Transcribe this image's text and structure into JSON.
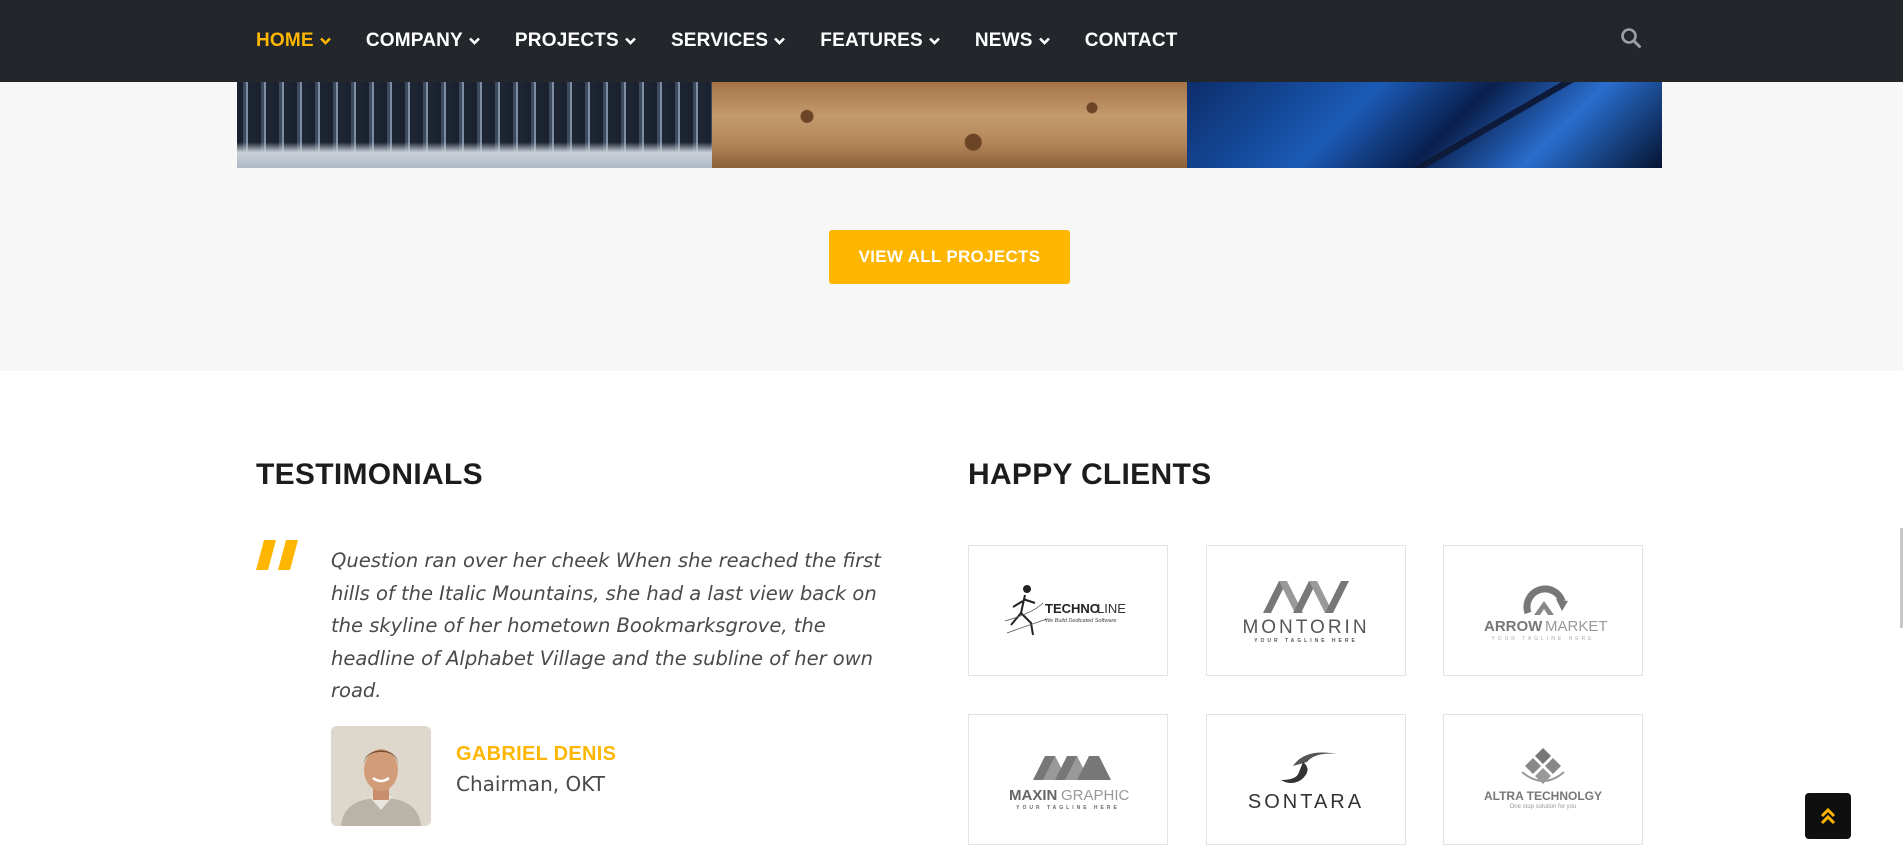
{
  "nav": {
    "items": [
      {
        "label": "HOME",
        "active": true
      },
      {
        "label": "COMPANY"
      },
      {
        "label": "PROJECTS"
      },
      {
        "label": "SERVICES"
      },
      {
        "label": "FEATURES"
      },
      {
        "label": "NEWS"
      },
      {
        "label": "CONTACT"
      }
    ],
    "search_icon": "search-icon"
  },
  "projects": {
    "button_label": "VIEW ALL PROJECTS"
  },
  "testimonials": {
    "title": "TESTIMONIALS",
    "quote": "Question ran over her cheek When she reached the first hills of the Italic Mountains, she had a last view back on the skyline of her hometown Bookmarksgrove, the headline of Alphabet Village and the subline of her own road.",
    "author_name": "GABRIEL DENIS",
    "author_role": "Chairman, OKT"
  },
  "clients": {
    "title": "HAPPY CLIENTS",
    "logos": [
      {
        "name": "TECHNO",
        "name2": "LINE",
        "tagline": "We Build Dedicated Software"
      },
      {
        "name": "MONTORIN",
        "tagline": "YOUR TAGLINE HERE"
      },
      {
        "name": "ARROW",
        "name2": "MARKET",
        "tagline": "YOUR TAGLINE HERE"
      },
      {
        "name": "MAXIN",
        "name2": "GRAPHIC",
        "tagline": "YOUR TAGLINE HERE"
      },
      {
        "name": "SONTARA"
      },
      {
        "name": "ALTRA TECHNOLGY",
        "tagline": "One stop solution for you"
      }
    ]
  },
  "colors": {
    "accent": "#ffb600",
    "nav_bg": "#23272b",
    "band_bg": "#f7f7f7"
  }
}
